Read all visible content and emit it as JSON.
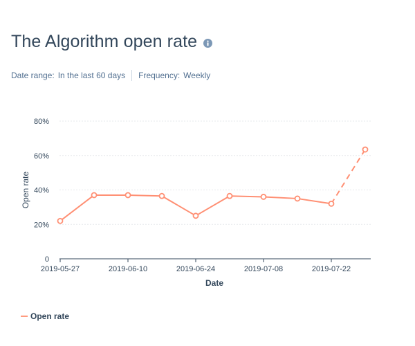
{
  "header": {
    "title": "The Algorithm open rate",
    "date_range_label": "Date range:",
    "date_range_value": "In the last 60 days",
    "frequency_label": "Frequency:",
    "frequency_value": "Weekly"
  },
  "colors": {
    "line": "#ff8f73",
    "grid": "#e5e8eb",
    "axis_text": "#33475b",
    "icon": "#7c98b6"
  },
  "legend": {
    "label": "Open rate"
  },
  "chart_data": {
    "type": "line",
    "xlabel": "Date",
    "ylabel": "Open rate",
    "ylim": [
      0,
      80
    ],
    "y_ticks": [
      "0",
      "20%",
      "40%",
      "60%",
      "80%"
    ],
    "y_tick_values": [
      0,
      20,
      40,
      60,
      80
    ],
    "x_tick_labels": [
      "2019-05-27",
      "2019-06-10",
      "2019-06-24",
      "2019-07-08",
      "2019-07-22"
    ],
    "x_tick_indices": [
      0,
      2,
      4,
      6,
      8
    ],
    "x": [
      "2019-05-27",
      "2019-06-03",
      "2019-06-10",
      "2019-06-17",
      "2019-06-24",
      "2019-07-01",
      "2019-07-08",
      "2019-07-15",
      "2019-07-22",
      "2019-07-29"
    ],
    "series": [
      {
        "name": "Open rate",
        "values": [
          22,
          37,
          37,
          36.5,
          25,
          36.5,
          36,
          35,
          32,
          63.5
        ],
        "dashed_last_segment": true
      }
    ],
    "grid": true,
    "legend_position": "bottom-left"
  }
}
